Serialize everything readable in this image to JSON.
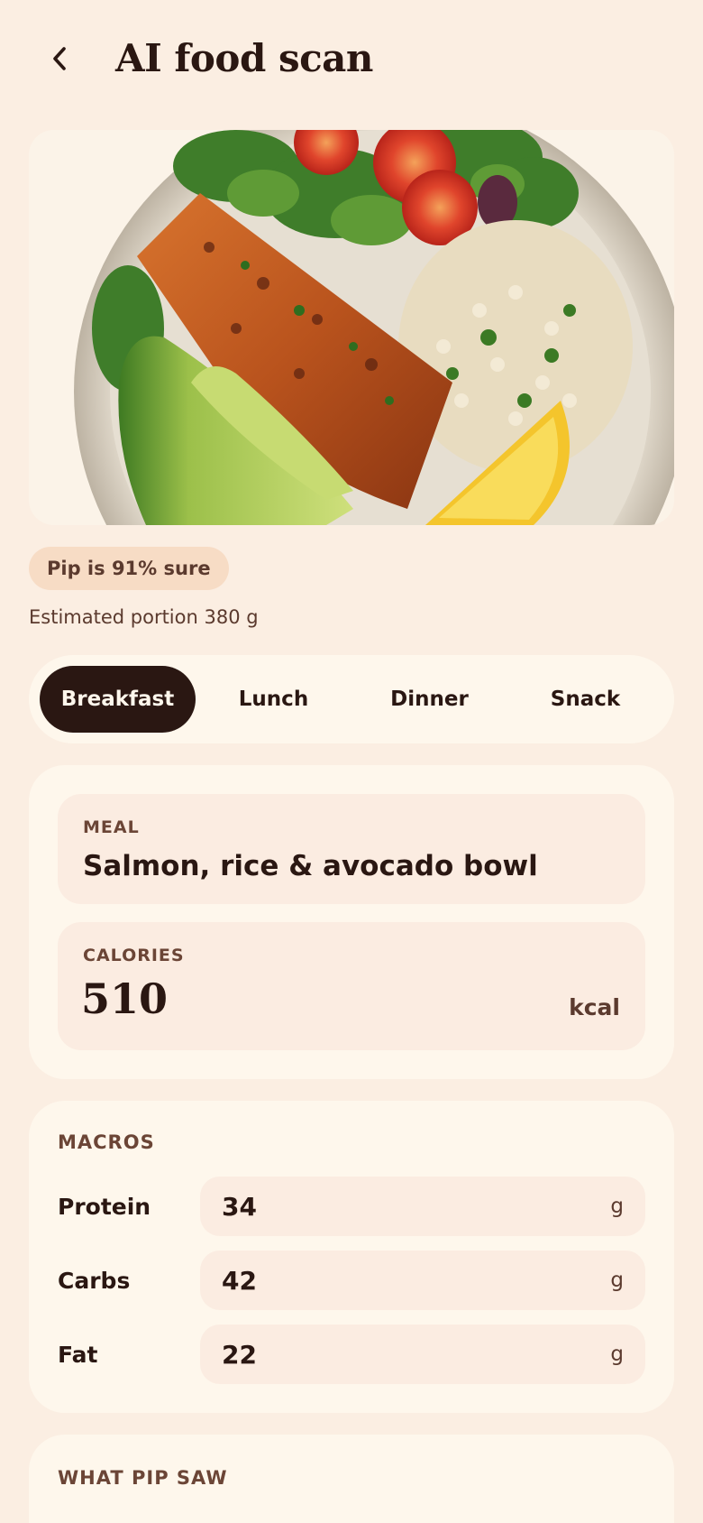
{
  "header": {
    "title": "AI food scan",
    "back_icon": "chevron-left-icon"
  },
  "photo": {
    "description_icon": "food-photo"
  },
  "confidence_badge": "Pip is 91% sure",
  "portion_text": "Estimated portion 380 g",
  "meal_tabs": [
    {
      "label": "Breakfast",
      "active": true
    },
    {
      "label": "Lunch",
      "active": false
    },
    {
      "label": "Dinner",
      "active": false
    },
    {
      "label": "Snack",
      "active": false
    }
  ],
  "meal_card": {
    "meal_label": "MEAL",
    "meal_value": "Salmon, rice & avocado bowl",
    "calories_label": "CALORIES",
    "calories_value": "510",
    "calories_unit": "kcal"
  },
  "macros": {
    "label": "MACROS",
    "items": [
      {
        "name": "Protein",
        "value": "34",
        "unit": "g"
      },
      {
        "name": "Carbs",
        "value": "42",
        "unit": "g"
      },
      {
        "name": "Fat",
        "value": "22",
        "unit": "g"
      }
    ]
  },
  "what_pip_saw": {
    "label": "WHAT PIP SAW"
  },
  "colors": {
    "background": "#fbeee2",
    "card": "#fef7ec",
    "field": "#fbece1",
    "dark": "#2a1712",
    "badge": "#f7dcc5"
  }
}
